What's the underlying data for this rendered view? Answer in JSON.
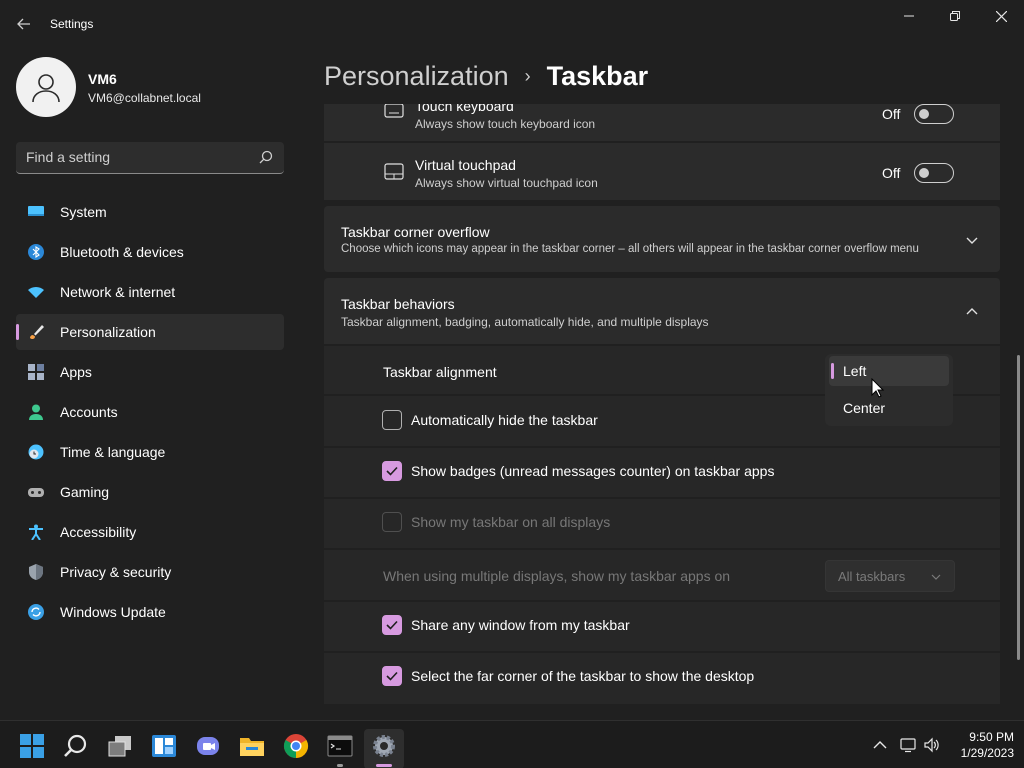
{
  "window": {
    "title": "Settings",
    "back_icon": "back-arrow-icon",
    "controls": [
      "minimize-icon",
      "maximize-icon",
      "close-icon"
    ]
  },
  "profile": {
    "name": "VM6",
    "email": "VM6@collabnet.local"
  },
  "search": {
    "placeholder": "Find a setting"
  },
  "sidebar": {
    "items": [
      {
        "label": "System",
        "icon": "system-icon",
        "color": "#4cc2ff"
      },
      {
        "label": "Bluetooth & devices",
        "icon": "bluetooth-icon",
        "color": "#2b88d8"
      },
      {
        "label": "Network & internet",
        "icon": "wifi-icon",
        "color": "#4cc2ff"
      },
      {
        "label": "Personalization",
        "icon": "brush-icon",
        "color": "#f7a046",
        "active": true
      },
      {
        "label": "Apps",
        "icon": "apps-icon",
        "color": "#a8b4c8"
      },
      {
        "label": "Accounts",
        "icon": "accounts-icon",
        "color": "#3ec98f"
      },
      {
        "label": "Time & language",
        "icon": "clock-globe-icon",
        "color": "#4cc2ff"
      },
      {
        "label": "Gaming",
        "icon": "gamepad-icon",
        "color": "#b0b0b0"
      },
      {
        "label": "Accessibility",
        "icon": "accessibility-icon",
        "color": "#4cc2ff"
      },
      {
        "label": "Privacy & security",
        "icon": "shield-icon",
        "color": "#9aa3ad"
      },
      {
        "label": "Windows Update",
        "icon": "update-icon",
        "color": "#3aa0e6"
      }
    ]
  },
  "breadcrumb": {
    "parent": "Personalization",
    "separator": "›",
    "current": "Taskbar"
  },
  "content": {
    "touch_keyboard": {
      "title": "Touch keyboard",
      "subtitle": "Always show touch keyboard icon",
      "state": "Off"
    },
    "virtual_touchpad": {
      "title": "Virtual touchpad",
      "subtitle": "Always show virtual touchpad icon",
      "state": "Off"
    },
    "corner_overflow": {
      "title": "Taskbar corner overflow",
      "subtitle": "Choose which icons may appear in the taskbar corner – all others will appear in the taskbar corner overflow menu"
    },
    "behaviors": {
      "title": "Taskbar behaviors",
      "subtitle": "Taskbar alignment, badging, automatically hide, and multiple displays",
      "alignment_label": "Taskbar alignment",
      "auto_hide": "Automatically hide the taskbar",
      "show_badges": "Show badges (unread messages counter) on taskbar apps",
      "all_displays": "Show my taskbar on all displays",
      "multi_display_label": "When using multiple displays, show my taskbar apps on",
      "multi_display_value": "All taskbars",
      "share_window": "Share any window from my taskbar",
      "far_corner": "Select the far corner of the taskbar to show the desktop"
    }
  },
  "alignment_menu": {
    "options": [
      "Left",
      "Center"
    ],
    "selected": "Left"
  },
  "accent_color": "#d79ae0",
  "taskbar": {
    "icons": [
      "start-icon",
      "search-icon",
      "task-view-icon",
      "widgets-icon",
      "teams-chat-icon",
      "file-explorer-icon",
      "chrome-icon",
      "terminal-icon",
      "settings-icon"
    ],
    "time": "9:50 PM",
    "date": "1/29/2023"
  }
}
